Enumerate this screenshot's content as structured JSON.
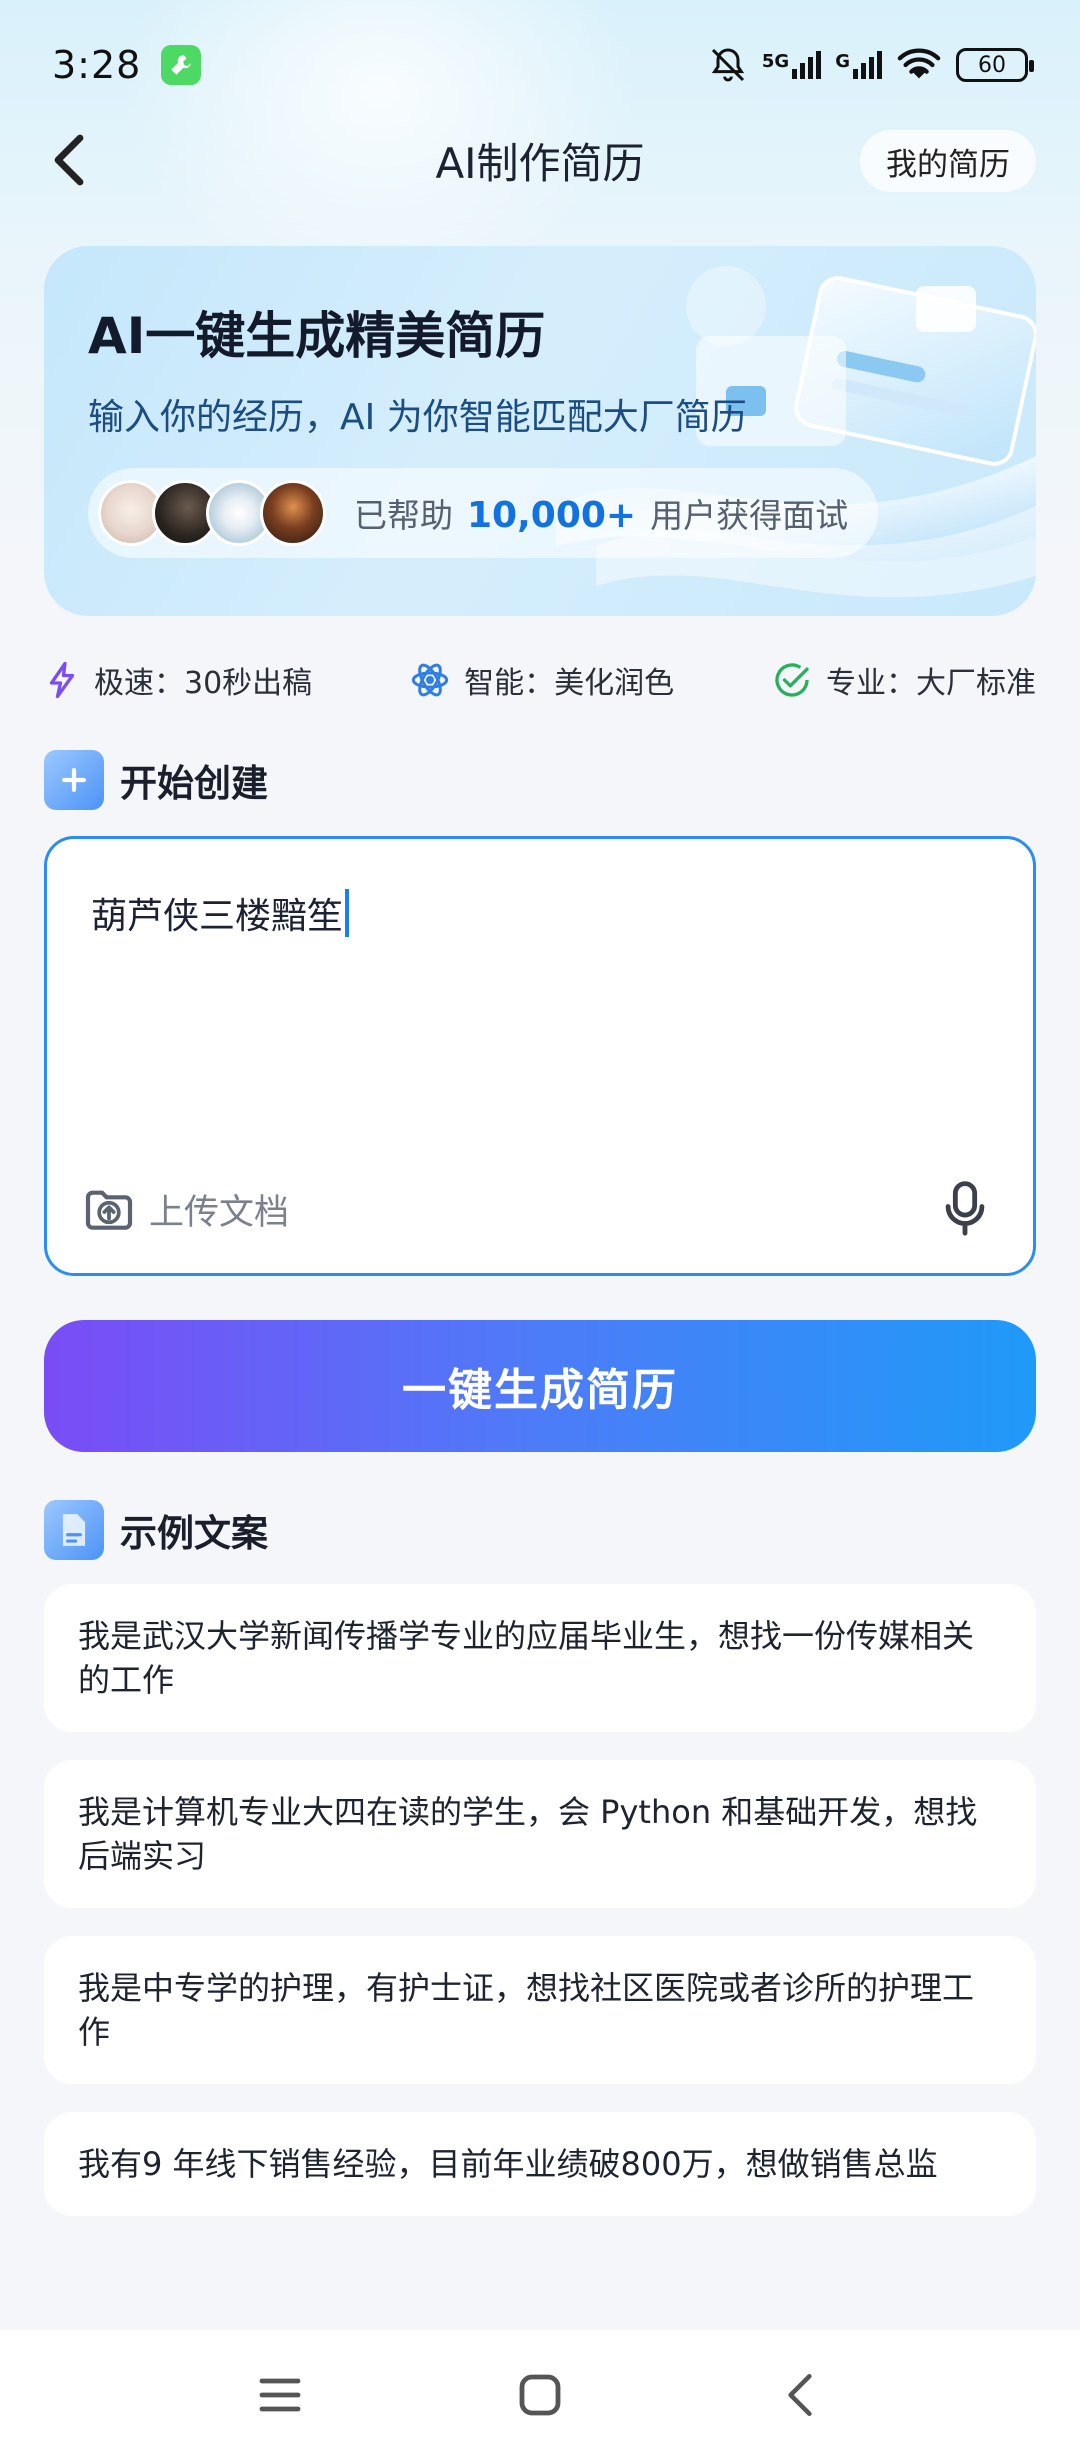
{
  "status_bar": {
    "time": "3:28",
    "signal_labels": [
      "5G",
      "G"
    ],
    "battery": "60",
    "icons": [
      "tool-app-icon",
      "bell-muted-icon",
      "signal-icon",
      "wifi-icon",
      "battery-icon"
    ]
  },
  "nav": {
    "title": "AI制作简历",
    "my_resume": "我的简历"
  },
  "banner": {
    "title": "AI一键生成精美简历",
    "subtitle": "输入你的经历，AI 为你智能匹配大厂简历",
    "helped_prefix": "已帮助",
    "helped_count": "10,000+",
    "helped_suffix": "用户获得面试"
  },
  "features": [
    {
      "label": "极速：30秒出稿",
      "icon": "lightning-icon",
      "color": "#7b4df2"
    },
    {
      "label": "智能：美化润色",
      "icon": "atom-icon",
      "color": "#2f7de6"
    },
    {
      "label": "专业：大厂标准",
      "icon": "check-circle-icon",
      "color": "#28b15b"
    }
  ],
  "create_section": {
    "title": "开始创建",
    "input_value": "葫芦侠三楼黯笙",
    "upload_label": "上传文档"
  },
  "generate_button": "一键生成简历",
  "examples_section": {
    "title": "示例文案",
    "items": [
      "我是武汉大学新闻传播学专业的应届毕业生，想找一份传媒相关的工作",
      "我是计算机专业大四在读的学生，会 Python 和基础开发，想找后端实习",
      "我是中专学的护理，有护士证，想找社区医院或者诊所的护理工作",
      "我有9 年线下销售经验，目前年业绩破800万，想做销售总监"
    ]
  },
  "colors": {
    "accent": "#2a8df2",
    "highlight": "#1273e0",
    "gradient_start": "#7a4cf6",
    "gradient_end": "#1f9af8"
  }
}
